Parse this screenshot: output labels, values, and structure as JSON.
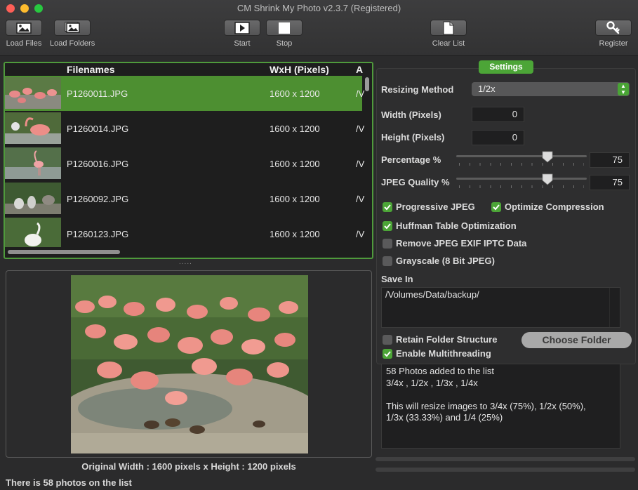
{
  "window": {
    "title": "CM Shrink My Photo v2.3.7 (Registered)"
  },
  "toolbar": {
    "load_files": "Load Files",
    "load_folders": "Load Folders",
    "start": "Start",
    "stop": "Stop",
    "clear_list": "Clear List",
    "register": "Register"
  },
  "file_list": {
    "columns": [
      "Filenames",
      "WxH (Pixels)",
      "A"
    ],
    "rows": [
      {
        "filename": "P1260011.JPG",
        "size": "1600 x 1200",
        "path": "/V"
      },
      {
        "filename": "P1260014.JPG",
        "size": "1600 x 1200",
        "path": "/V"
      },
      {
        "filename": "P1260016.JPG",
        "size": "1600 x 1200",
        "path": "/V"
      },
      {
        "filename": "P1260092.JPG",
        "size": "1600 x 1200",
        "path": "/V"
      },
      {
        "filename": "P1260123.JPG",
        "size": "1600 x 1200",
        "path": "/V"
      }
    ],
    "splitter": "....."
  },
  "preview": {
    "original_size": "Original Width : 1600 pixels x Height : 1200 pixels"
  },
  "status": {
    "text": "There is 58 photos on the list"
  },
  "settings": {
    "tab_label": "Settings",
    "resizing_method_label": "Resizing Method",
    "resizing_method_value": "1/2x",
    "width_label": "Width (Pixels)",
    "width_value": "0",
    "height_label": "Height (Pixels)",
    "height_value": "0",
    "percentage_label": "Percentage %",
    "percentage_value": "75",
    "jpeg_quality_label": "JPEG Quality %",
    "jpeg_quality_value": "75",
    "progressive_jpeg": "Progressive JPEG",
    "optimize_compression": "Optimize Compression",
    "huffman": "Huffman Table Optimization",
    "remove_exif": "Remove JPEG EXIF  IPTC Data",
    "grayscale": "Grayscale (8 Bit JPEG)",
    "save_in_label": "Save In",
    "save_in_value": "/Volumes/Data/backup/",
    "retain_folder": "Retain Folder Structure",
    "multithreading": "Enable Multithreading",
    "choose_folder": "Choose Folder",
    "checked": {
      "progressive_jpeg": true,
      "optimize_compression": true,
      "huffman": true,
      "remove_exif": false,
      "grayscale": false,
      "retain_folder": false,
      "multithreading": true
    }
  },
  "log": {
    "lines": [
      "58 Photos added to the list",
      "3/4x , 1/2x , 1/3x , 1/4x",
      "",
      "This will resize images to 3/4x (75%), 1/2x (50%),",
      "1/3x (33.33%) and 1/4 (25%)"
    ]
  },
  "colors": {
    "accent": "#4ca537",
    "selection": "#4d8f31",
    "panel": "#2b2b2c"
  }
}
